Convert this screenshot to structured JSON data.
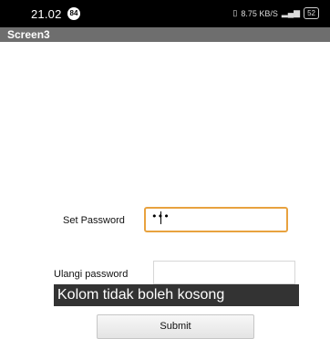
{
  "status_bar": {
    "time": "21.02",
    "badge": "84",
    "net_speed": "8.75 KB/S",
    "battery": "52"
  },
  "title_bar": {
    "title": "Screen3"
  },
  "form": {
    "set_password_label": "Set Password",
    "set_password_value": "•••",
    "ulangi_password_label": "Ulangi password",
    "ulangi_password_value": "",
    "submit_label": "Submit"
  },
  "toast": {
    "message": "Kolom tidak boleh kosong"
  },
  "colors": {
    "focus_border": "#e8a23f",
    "title_bar": "#6e6e6e",
    "toast_bg": "#333333"
  }
}
